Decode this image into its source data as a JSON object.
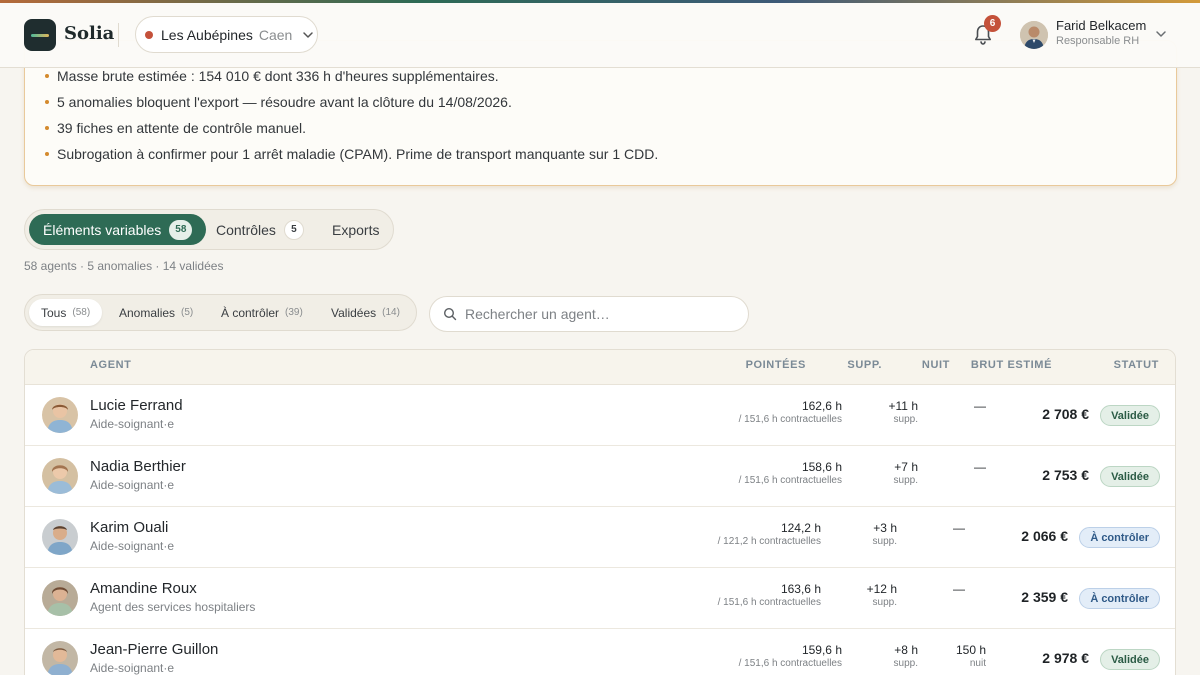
{
  "app": {
    "name": "Solia"
  },
  "site": {
    "name": "Les Aubépines",
    "city": "Caen",
    "status_color": "#c4513a"
  },
  "notifications": {
    "count": "6"
  },
  "user": {
    "name": "Farid Belkacem",
    "role": "Responsable RH"
  },
  "summary": {
    "items": [
      "Masse brute estimée : 154 010 € dont 336 h d'heures supplémentaires.",
      "5 anomalies bloquent l'export — résoudre avant la clôture du 14/08/2026.",
      "39 fiches en attente de contrôle manuel.",
      "Subrogation à confirmer pour 1 arrêt maladie (CPAM). Prime de transport manquante sur 1 CDD."
    ]
  },
  "main_tabs": [
    {
      "label": "Éléments variables",
      "count": "58",
      "active": true
    },
    {
      "label": "Contrôles",
      "count": "5",
      "active": false
    },
    {
      "label": "Exports",
      "count": "",
      "active": false
    }
  ],
  "stats_line": "58 agents · 5 anomalies · 14 validées",
  "filters": [
    {
      "label": "Tous",
      "count": "(58)",
      "active": true
    },
    {
      "label": "Anomalies",
      "count": "(5)",
      "active": false
    },
    {
      "label": "À contrôler",
      "count": "(39)",
      "active": false
    },
    {
      "label": "Validées",
      "count": "(14)",
      "active": false
    }
  ],
  "search": {
    "placeholder": "Rechercher un agent…",
    "value": ""
  },
  "table": {
    "headers": {
      "agent": "AGENT",
      "pointees": "POINTÉES",
      "supp": "SUPP.",
      "nuit": "NUIT",
      "brut": "BRUT ESTIMÉ",
      "statut": "STATUT"
    },
    "rows": [
      {
        "name": "Lucie Ferrand",
        "role": "Aide-soignant·e",
        "hours": "162,6 h",
        "contract": "/ 151,6 h contractuelles",
        "supp": "+11 h",
        "supp_label": "supp.",
        "night": "—",
        "night_label": "",
        "brut": "2 708 €",
        "status": "Validée",
        "status_kind": "ok"
      },
      {
        "name": "Nadia Berthier",
        "role": "Aide-soignant·e",
        "hours": "158,6 h",
        "contract": "/ 151,6 h contractuelles",
        "supp": "+7 h",
        "supp_label": "supp.",
        "night": "—",
        "night_label": "",
        "brut": "2 753 €",
        "status": "Validée",
        "status_kind": "ok"
      },
      {
        "name": "Karim Ouali",
        "role": "Aide-soignant·e",
        "hours": "124,2 h",
        "contract": "/ 121,2 h contractuelles",
        "supp": "+3 h",
        "supp_label": "supp.",
        "night": "—",
        "night_label": "",
        "brut": "2 066 €",
        "status": "À contrôler",
        "status_kind": "check"
      },
      {
        "name": "Amandine Roux",
        "role": "Agent des services hospitaliers",
        "hours": "163,6 h",
        "contract": "/ 151,6 h contractuelles",
        "supp": "+12 h",
        "supp_label": "supp.",
        "night": "—",
        "night_label": "",
        "brut": "2 359 €",
        "status": "À contrôler",
        "status_kind": "check"
      },
      {
        "name": "Jean-Pierre Guillon",
        "role": "Aide-soignant·e",
        "hours": "159,6 h",
        "contract": "/ 151,6 h contractuelles",
        "supp": "+8 h",
        "supp_label": "supp.",
        "night": "150 h",
        "night_label": "nuit",
        "brut": "2 978 €",
        "status": "Validée",
        "status_kind": "ok"
      }
    ]
  }
}
